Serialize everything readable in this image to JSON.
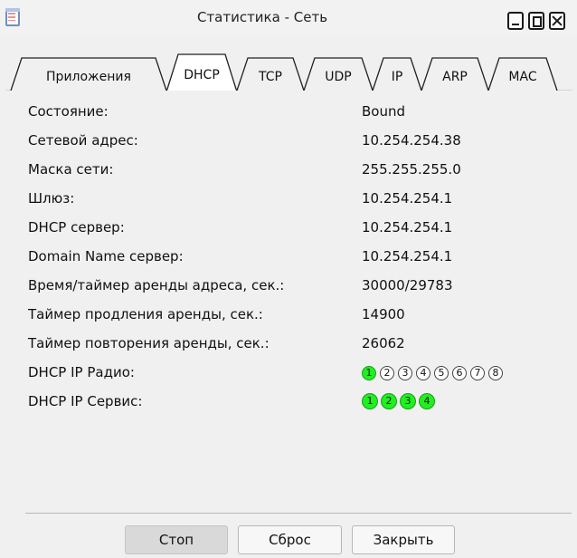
{
  "window": {
    "title": "Статистика - Сеть"
  },
  "tabs": [
    {
      "label": "Приложения",
      "active": false
    },
    {
      "label": "DHCP",
      "active": true
    },
    {
      "label": "TCP",
      "active": false
    },
    {
      "label": "UDP",
      "active": false
    },
    {
      "label": "IP",
      "active": false
    },
    {
      "label": "ARP",
      "active": false
    },
    {
      "label": "MAC",
      "active": false
    }
  ],
  "dhcp": {
    "rows": [
      {
        "label": "Состояние:",
        "value": "Bound"
      },
      {
        "label": "Сетевой адрес:",
        "value": "10.254.254.38"
      },
      {
        "label": "Маска сети:",
        "value": "255.255.255.0"
      },
      {
        "label": "Шлюз:",
        "value": "10.254.254.1"
      },
      {
        "label": "DHCP сервер:",
        "value": "10.254.254.1"
      },
      {
        "label": "Domain Name сервер:",
        "value": "10.254.254.1"
      },
      {
        "label": "Время/таймер аренды адреса, сек.:",
        "value": "30000/29783"
      },
      {
        "label": "Таймер продления аренды, сек.:",
        "value": "14900"
      },
      {
        "label": "Таймер повторения аренды, сек.:",
        "value": "26062"
      }
    ],
    "radio": {
      "label": "DHCP IP Радио:",
      "items": [
        {
          "num": "1",
          "active": true
        },
        {
          "num": "2",
          "active": false
        },
        {
          "num": "3",
          "active": false
        },
        {
          "num": "4",
          "active": false
        },
        {
          "num": "5",
          "active": false
        },
        {
          "num": "6",
          "active": false
        },
        {
          "num": "7",
          "active": false
        },
        {
          "num": "8",
          "active": false
        }
      ]
    },
    "service": {
      "label": "DHCP IP Сервис:",
      "items": [
        {
          "num": "1",
          "active": true
        },
        {
          "num": "2",
          "active": true
        },
        {
          "num": "3",
          "active": true
        },
        {
          "num": "4",
          "active": true
        }
      ]
    }
  },
  "buttons": {
    "stop": "Стоп",
    "reset": "Сброс",
    "close": "Закрыть"
  },
  "colors": {
    "active_indicator": "#22ee22",
    "background": "#f0f0f0"
  }
}
